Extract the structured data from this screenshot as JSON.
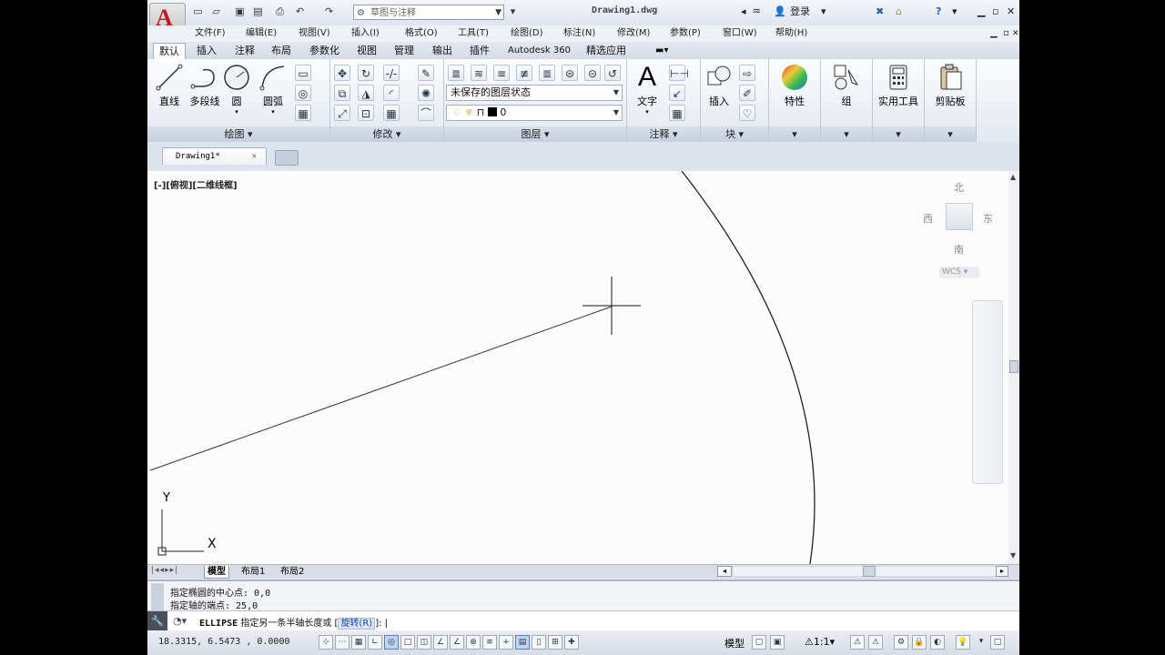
{
  "app": {
    "logo_letter": "A",
    "workspace": "草图与注释",
    "document_title": "Drawing1.dwg",
    "login_label": "登录",
    "help_label": "?"
  },
  "menu": [
    "文件(F)",
    "编辑(E)",
    "视图(V)",
    "插入(I)",
    "格式(O)",
    "工具(T)",
    "绘图(D)",
    "标注(N)",
    "修改(M)",
    "参数(P)",
    "窗口(W)",
    "帮助(H)"
  ],
  "ribbon_tabs": [
    "默认",
    "插入",
    "注释",
    "布局",
    "参数化",
    "视图",
    "管理",
    "输出",
    "插件",
    "Autodesk 360",
    "精选应用"
  ],
  "ribbon": {
    "draw": {
      "title": "绘图",
      "tools": [
        "直线",
        "多段线",
        "圆",
        "圆弧"
      ]
    },
    "modify": {
      "title": "修改"
    },
    "layers": {
      "title": "图层",
      "state_combo": "未保存的图层状态",
      "layer_combo": "0"
    },
    "annotation": {
      "title": "注释",
      "text_label": "文字"
    },
    "block": {
      "title": "块",
      "insert_label": "插入"
    },
    "properties": {
      "label": "特性"
    },
    "groups": {
      "label": "组"
    },
    "utilities": {
      "label": "实用工具"
    },
    "clipboard": {
      "label": "剪贴板"
    }
  },
  "file_tab": {
    "label": "Drawing1*"
  },
  "viewport": {
    "label": "[-][俯视][二维线框]",
    "viewcube": {
      "north": "北",
      "west": "西",
      "east": "东",
      "south": "南",
      "wcs": "WCS"
    },
    "ucs": {
      "x": "X",
      "y": "Y"
    }
  },
  "layout_tabs": [
    "模型",
    "布局1",
    "布局2"
  ],
  "command_history": [
    "指定椭圆的中心点: 0,0",
    "指定轴的端点: 25,0"
  ],
  "command_line": {
    "command": "ELLIPSE",
    "prompt": "指定另一条半轴长度或 [",
    "option": "旋转(R)",
    "suffix": "]:"
  },
  "status": {
    "coordinates": "18.3315, 6.5473 , 0.0000",
    "model_label": "模型",
    "scale": "1:1"
  },
  "colors": {
    "accent_red": "#c8141b",
    "ribbon_bg": "#e3e8f0",
    "canvas_bg": "#fcfcfc"
  }
}
